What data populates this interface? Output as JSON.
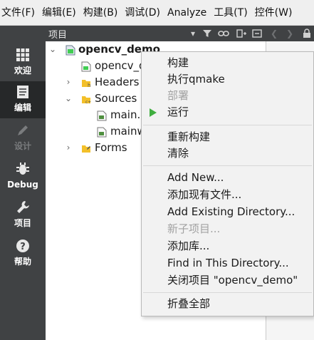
{
  "menubar": {
    "items": [
      "文件(F)",
      "编辑(E)",
      "构建(B)",
      "调试(D)",
      "Analyze",
      "工具(T)",
      "控件(W)"
    ]
  },
  "modes": [
    {
      "label": "欢迎",
      "icon": "grid-icon"
    },
    {
      "label": "编辑",
      "icon": "document-icon"
    },
    {
      "label": "设计",
      "icon": "pencil-icon"
    },
    {
      "label": "Debug",
      "icon": "bug-icon"
    },
    {
      "label": "项目",
      "icon": "wrench-icon"
    },
    {
      "label": "帮助",
      "icon": "help-icon"
    }
  ],
  "projects_pane": {
    "title": "项目"
  },
  "tree": {
    "items": [
      {
        "label": "opencv_demo",
        "kind": "project",
        "expanded": true
      },
      {
        "label": "opencv_d",
        "kind": "pro-file"
      },
      {
        "label": "Headers",
        "kind": "folder-headers",
        "expanded": false
      },
      {
        "label": "Sources",
        "kind": "folder-sources",
        "expanded": true
      },
      {
        "label": "main.c",
        "kind": "cpp-file"
      },
      {
        "label": "mainw",
        "kind": "cpp-file"
      },
      {
        "label": "Forms",
        "kind": "folder-forms",
        "expanded": false
      }
    ]
  },
  "context_menu": {
    "items": [
      {
        "label": "构建",
        "enabled": true
      },
      {
        "label": "执行qmake",
        "enabled": true
      },
      {
        "label": "部署",
        "enabled": false
      },
      {
        "label": "运行",
        "enabled": true,
        "icon": "run-icon"
      },
      {
        "label": "重新构建",
        "enabled": true
      },
      {
        "label": "清除",
        "enabled": true
      },
      {
        "label": "Add New...",
        "enabled": true
      },
      {
        "label": "添加现有文件...",
        "enabled": true
      },
      {
        "label": "Add Existing Directory...",
        "enabled": true
      },
      {
        "label": "新子项目...",
        "enabled": false
      },
      {
        "label": "添加库...",
        "enabled": true
      },
      {
        "label": "Find in This Directory...",
        "enabled": true
      },
      {
        "label": "关闭项目 \"opencv_demo\"",
        "enabled": true
      },
      {
        "label": "折叠全部",
        "enabled": true
      }
    ]
  },
  "colors": {
    "sidebar_bg": "#404244",
    "sidebar_active": "#262829",
    "selection": "#d7dde6",
    "menu_bg": "#f2f2f2",
    "run_green": "#3fae3f"
  }
}
